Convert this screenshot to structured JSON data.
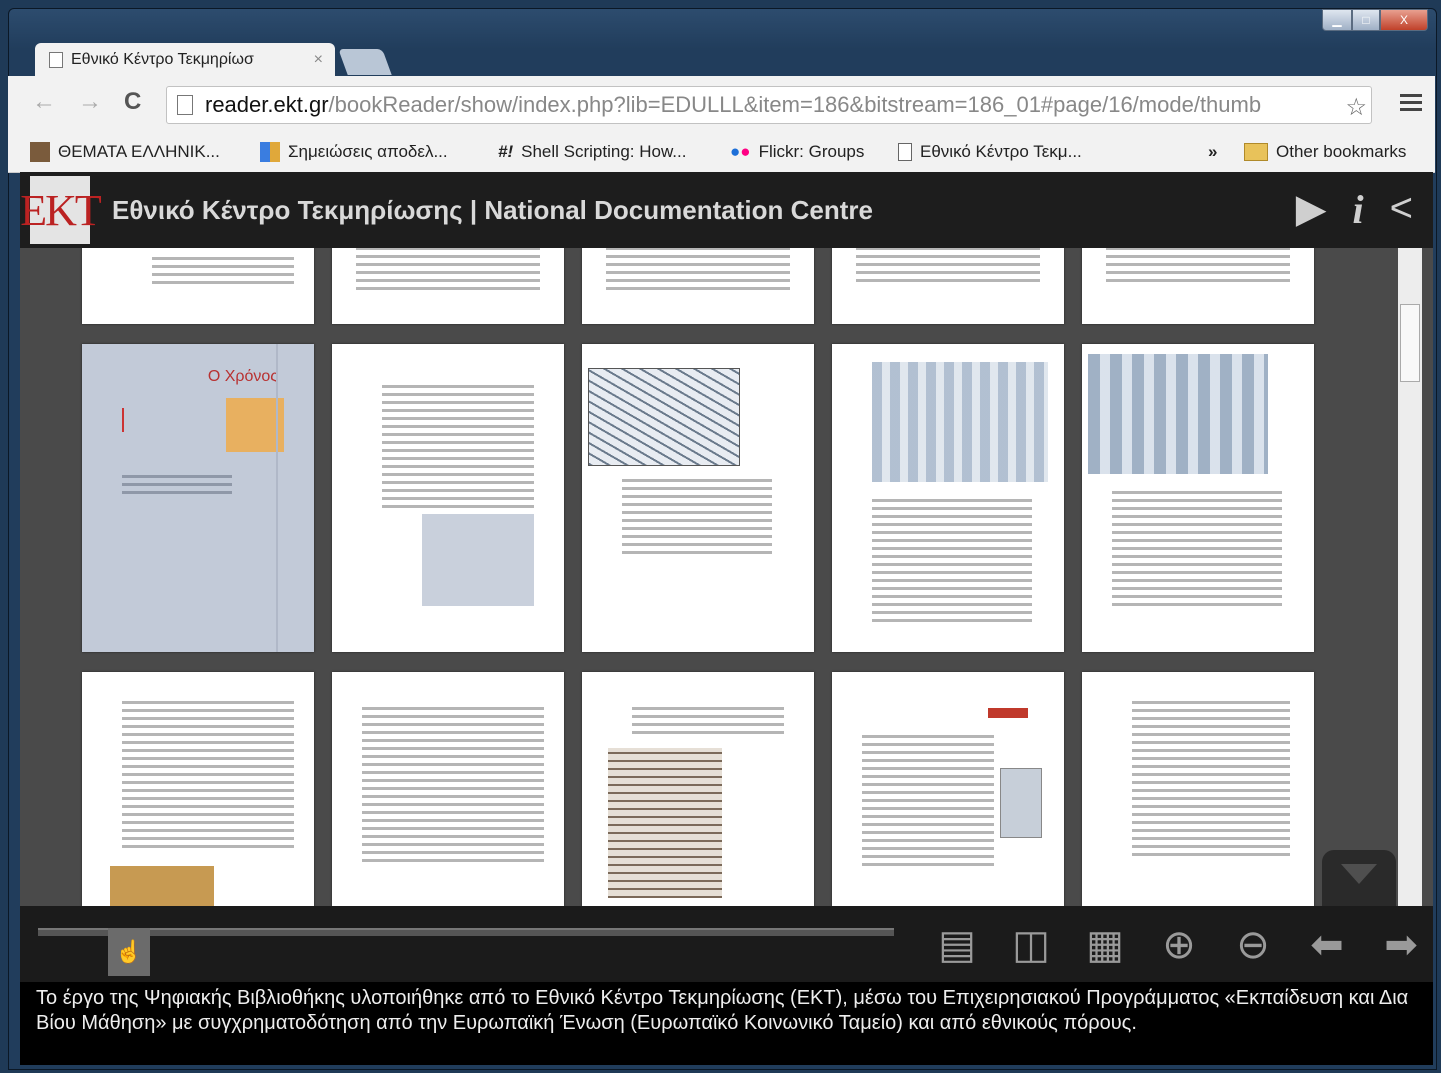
{
  "browser": {
    "tab_title": "Εθνικό Κέντρο Τεκμηρίωσ",
    "tab_close": "×",
    "url_host": "reader.ekt.gr",
    "url_path": "/bookReader/show/index.php?lib=EDULLL&item=186&bitstream=186_01#page/16/mode/thumb",
    "back": "←",
    "forward": "→",
    "reload": "C",
    "star": "☆",
    "window": {
      "min": "▁",
      "max": "□",
      "close": "X"
    }
  },
  "bookmarks": [
    {
      "label": "ΘΕΜΑΤΑ ΕΛΛΗΝΙΚ...",
      "icon": "photo-icon"
    },
    {
      "label": "Σημειώσεις αποδελ...",
      "icon": "puzzle-icon"
    },
    {
      "label": "Shell Scripting: How...",
      "icon": "hash-icon",
      "prefix": "#!"
    },
    {
      "label": "Flickr: Groups",
      "icon": "flickr-icon"
    },
    {
      "label": "Εθνικό Κέντρο Τεκμ...",
      "icon": "page-icon"
    }
  ],
  "bookmarks_more": "»",
  "other_bookmarks": "Other bookmarks",
  "reader": {
    "logo": "EKT",
    "title": "Εθνικό Κέντρο Τεκμηρίωσης | National Documentation Centre",
    "header_icons": [
      "play-icon",
      "info-icon",
      "share-icon"
    ],
    "chapter_title": "Ο Χρόνος",
    "footer_text": "Το έργο της Ψηφιακής Βιβλιοθήκης υλοποιήθηκε από το Εθνικό Κέντρο Τεκμηρίωσης (ΕΚΤ), μέσω του Επιχειρησιακού Προγράμματος «Εκπαίδευση και Δια Βίου Μάθηση» με συγχρηματοδότηση από την Ευρωπαϊκή Ένωση (Ευρωπαϊκό Κοινωνικό Ταμείο) και από εθνικούς πόρους.",
    "nav_icons": [
      "one-page-icon",
      "two-page-icon",
      "thumbnails-icon",
      "zoom-in-icon",
      "zoom-out-icon",
      "prev-icon",
      "next-icon"
    ],
    "thumbnail_rows": 3,
    "thumbnail_cols": 5
  }
}
